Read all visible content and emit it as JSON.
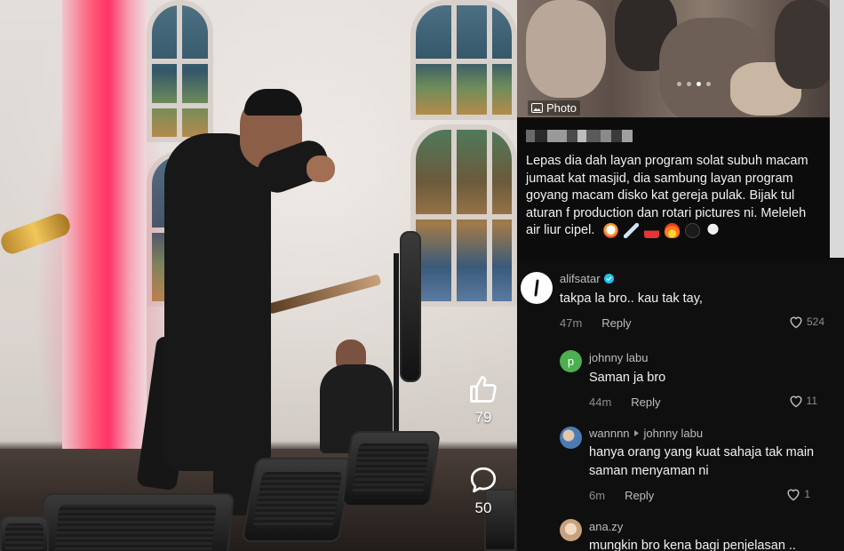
{
  "video": {
    "like_count": "79",
    "comment_count": "50",
    "like_icon": "thumbs-up-icon",
    "comment_icon": "speech-bubble-icon"
  },
  "post": {
    "photo_label": "Photo",
    "carousel_dots": 4,
    "carousel_active": 3,
    "caption": "Lepas dia dah layan program solat subuh macam jumaat kat masjid, dia sambung layan program goyang macam disko kat gereja pulak. Bijak tul aturan f production dan rotari pictures ni. Meleleh air liur cipel.",
    "caption_emojis": [
      "clown-face",
      "syringe",
      "hot-springs",
      "fire",
      "black-heart",
      "skull-and-crossbones"
    ]
  },
  "comments": [
    {
      "user": "alifsatar",
      "verified": true,
      "text": "takpa la bro.. kau tak tay,",
      "time": "47m",
      "reply_label": "Reply",
      "likes": "524",
      "avatar_letter": "",
      "avatar_color": "#ffffff"
    },
    {
      "user": "johnny labu",
      "text": "Saman ja bro",
      "time": "44m",
      "reply_label": "Reply",
      "likes": "11",
      "avatar_letter": "p",
      "avatar_color": "#4caf50"
    },
    {
      "user": "wannnn",
      "reply_to": "johnny labu",
      "text_lines": [
        "hanya orang yang kuat sahaja tak main",
        "saman menyaman ni"
      ],
      "time": "6m",
      "reply_label": "Reply",
      "likes": "1",
      "avatar_color": "#4a7bb5"
    },
    {
      "user": "ana.zy",
      "text": "mungkin bro kena bagi penjelasan ..",
      "avatar_color": "#c9a27d"
    }
  ]
}
